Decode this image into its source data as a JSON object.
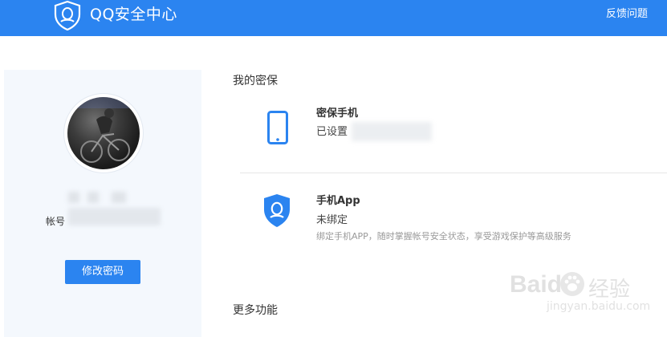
{
  "header": {
    "brand": "QQ安全中心",
    "feedback_label": "反馈问题"
  },
  "sidebar": {
    "account_label": "帐号",
    "change_password_label": "修改密码"
  },
  "main": {
    "my_security_title": "我的密保",
    "items": [
      {
        "title": "密保手机",
        "status": "已设置",
        "icon": "phone-icon"
      },
      {
        "title": "手机App",
        "status": "未绑定",
        "description": "绑定手机APP，随时掌握帐号安全状态，享受游戏保护等高级服务",
        "icon": "qq-shield-icon"
      }
    ],
    "more_features_title": "更多功能"
  },
  "watermark": {
    "logo_text": "Baidu",
    "jingyan_text": "经验",
    "url": "jingyan.baidu.com"
  },
  "colors": {
    "brand_blue": "#2b84f0",
    "sidebar_bg": "#f4f8fd"
  }
}
